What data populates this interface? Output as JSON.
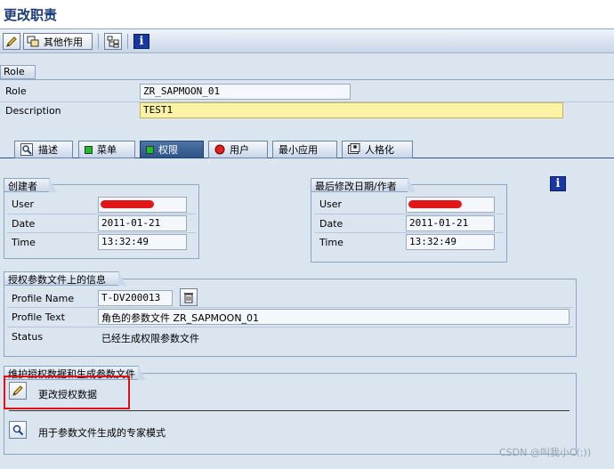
{
  "window": {
    "title": "更改职责"
  },
  "toolbar": {
    "other_functions_label": "其他作用"
  },
  "role_section": {
    "header": "Role",
    "role_label": "Role",
    "role_value": "ZR_SAPMOON_01",
    "description_label": "Description",
    "description_value": "TEST1"
  },
  "tabs": [
    {
      "label": "描述",
      "icon": "magnifier-icon"
    },
    {
      "label": "菜单",
      "icon": "green-status-icon",
      "color": "#1fbf2a"
    },
    {
      "label": "权限",
      "icon": "green-status-icon",
      "color": "#1fbf2a"
    },
    {
      "label": "用户",
      "icon": "red-status-icon",
      "color": "#e0201c"
    },
    {
      "label": "最小应用"
    },
    {
      "label": "人格化",
      "icon": "personalization-icon"
    }
  ],
  "creator": {
    "header": "创建者",
    "user_label": "User",
    "date_label": "Date",
    "date_value": "2011-01-21",
    "time_label": "Time",
    "time_value": "13:32:49"
  },
  "last_changed": {
    "header": "最后修改日期/作者",
    "user_label": "User",
    "date_label": "Date",
    "date_value": "2011-01-21",
    "time_label": "Time",
    "time_value": "13:32:49"
  },
  "profile_info": {
    "header": "授权参数文件上的信息",
    "profile_name_label": "Profile Name",
    "profile_name_value": "T-DV200013",
    "profile_text_label": "Profile Text",
    "profile_text_value": "角色的参数文件 ZR_SAPMOON_01",
    "status_label": "Status",
    "status_value": "已经生成权限参数文件"
  },
  "maintain": {
    "header": "维护授权数据和生成参数文件",
    "change_auth_label": "更改授权数据",
    "expert_mode_label": "用于参数文件生成的专家模式"
  },
  "highlight_color": "#e01010",
  "watermark": "CSDN @叫我小C(;))"
}
